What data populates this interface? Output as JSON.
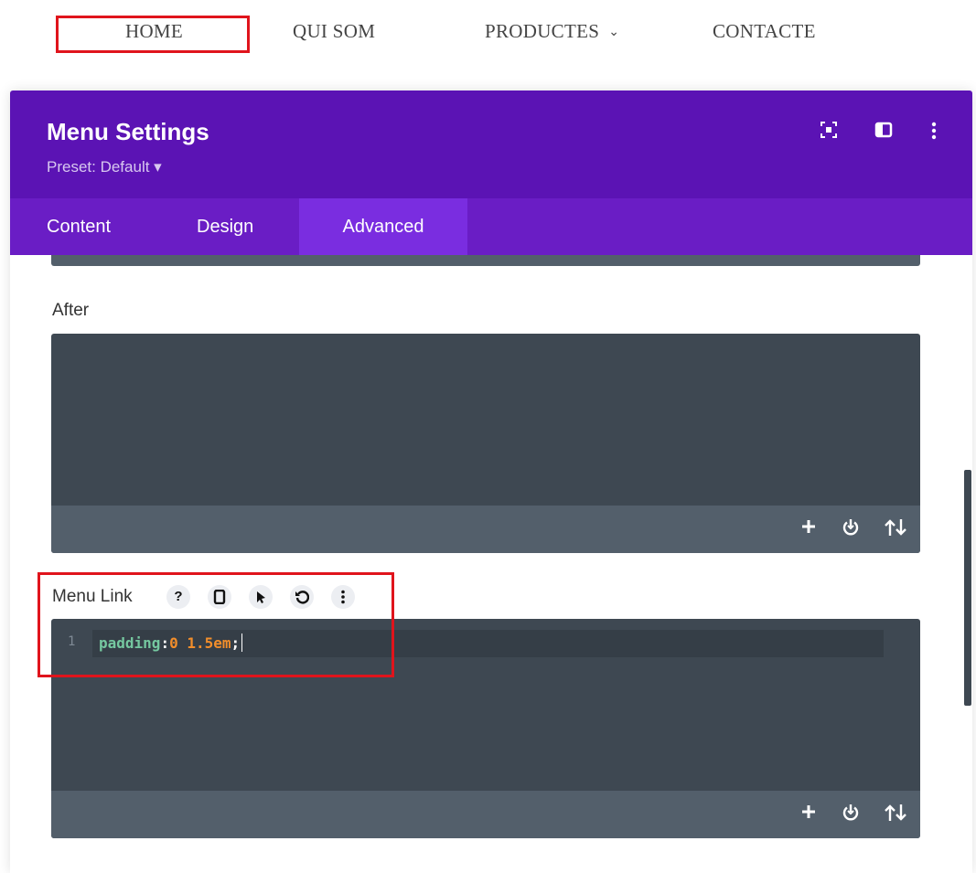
{
  "nav": {
    "home": "HOME",
    "qui_som": "QUI SOM",
    "productes": "PRODUCTES",
    "contacte": "CONTACTE",
    "productes_chevron": "⌄"
  },
  "panel": {
    "title": "Menu Settings",
    "preset": "Preset: Default ▾",
    "header_icons": [
      "focus-icon",
      "split-view-icon",
      "more-vertical-icon"
    ],
    "tabs": [
      {
        "label": "Content",
        "active": false
      },
      {
        "label": "Design",
        "active": false
      },
      {
        "label": "Advanced",
        "active": true
      }
    ]
  },
  "after_field": {
    "label": "After",
    "code": ""
  },
  "menu_link_field": {
    "label": "Menu Link",
    "actions": [
      "help-icon",
      "responsive-icon",
      "hover-icon",
      "reset-icon",
      "more-icon"
    ],
    "line_number": "1",
    "code_property": "padding",
    "code_colon": ":",
    "code_value": "0 1.5em",
    "code_semicolon": ";"
  },
  "toolbar_icons": [
    "plus-icon",
    "power-icon",
    "sort-icon"
  ],
  "colors": {
    "header_purple": "#5b13b4",
    "tabs_purple": "#6a1dc5",
    "active_tab": "#7a2de0",
    "editor_bg": "#3e4852",
    "editor_toolbar": "#535f6b",
    "highlight_red": "#e0141c"
  }
}
